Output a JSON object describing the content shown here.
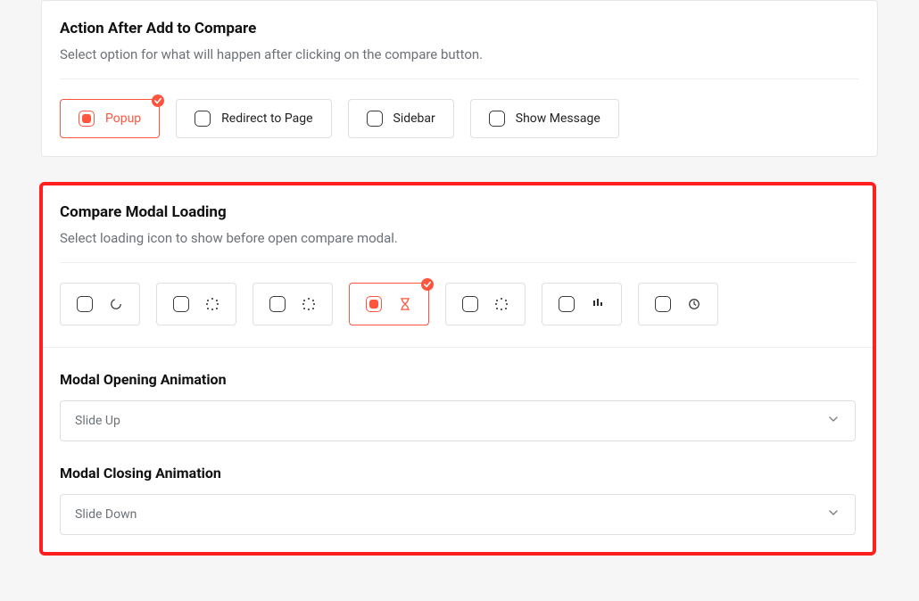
{
  "action_section": {
    "title": "Action After Add to Compare",
    "subtitle": "Select option for what will happen after clicking on the compare button.",
    "options": [
      {
        "label": "Popup",
        "selected": true
      },
      {
        "label": "Redirect to Page",
        "selected": false
      },
      {
        "label": "Sidebar",
        "selected": false
      },
      {
        "label": "Show Message",
        "selected": false
      }
    ]
  },
  "loading_section": {
    "title": "Compare Modal Loading",
    "subtitle": "Select loading icon to show before open compare modal.",
    "icons": [
      {
        "name": "spinner-arc",
        "selected": false
      },
      {
        "name": "spinner-dots-1",
        "selected": false
      },
      {
        "name": "spinner-dots-2",
        "selected": false
      },
      {
        "name": "hourglass",
        "selected": true
      },
      {
        "name": "spinner-dots-3",
        "selected": false
      },
      {
        "name": "bars",
        "selected": false
      },
      {
        "name": "clock",
        "selected": false
      }
    ]
  },
  "open_anim": {
    "title": "Modal Opening Animation",
    "value": "Slide Up"
  },
  "close_anim": {
    "title": "Modal Closing Animation",
    "value": "Slide Down"
  }
}
